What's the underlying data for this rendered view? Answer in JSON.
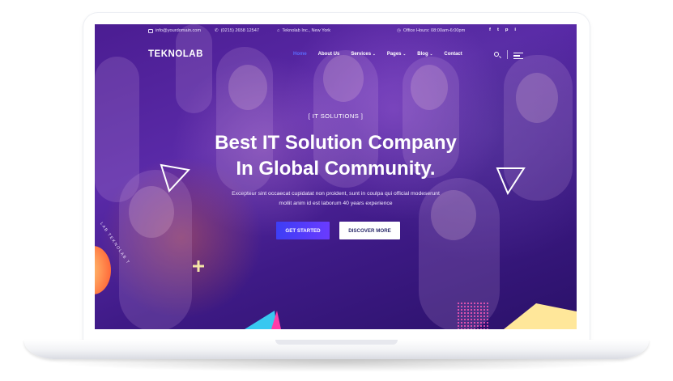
{
  "topbar": {
    "email": "info@yourdomain.com",
    "phone": "(0215) 2658 12547",
    "address": "Teknolab Inc., New York",
    "hours": "Office Hours: 08:00am-6:00pm",
    "social": [
      "f",
      "t",
      "p",
      "i"
    ]
  },
  "nav": {
    "logo": "TEKNOLAB",
    "items": [
      {
        "label": "Home",
        "active": true
      },
      {
        "label": "About Us"
      },
      {
        "label": "Services",
        "dropdown": true
      },
      {
        "label": "Pages",
        "dropdown": true
      },
      {
        "label": "Blog",
        "dropdown": true
      },
      {
        "label": "Contact"
      }
    ]
  },
  "hero": {
    "eyebrow": "[ IT SOLUTIONS ]",
    "headline_line1": "Best IT Solution Company",
    "headline_line2": "In Global Community.",
    "sub_line1": "Excepteur sint occaecat cupidatat non proident, sunt in coulpa qui official modeserunt",
    "sub_line2": "mollit anim id est laborum 40 years experience",
    "primary_button": "GET STARTED",
    "secondary_button": "DISCOVER MORE",
    "badge_text": "LAB TEKNOLAB T"
  },
  "colors": {
    "primary": "#3d3ef5",
    "accent": "#ff5ab8",
    "overlay": "#4b1d92"
  }
}
